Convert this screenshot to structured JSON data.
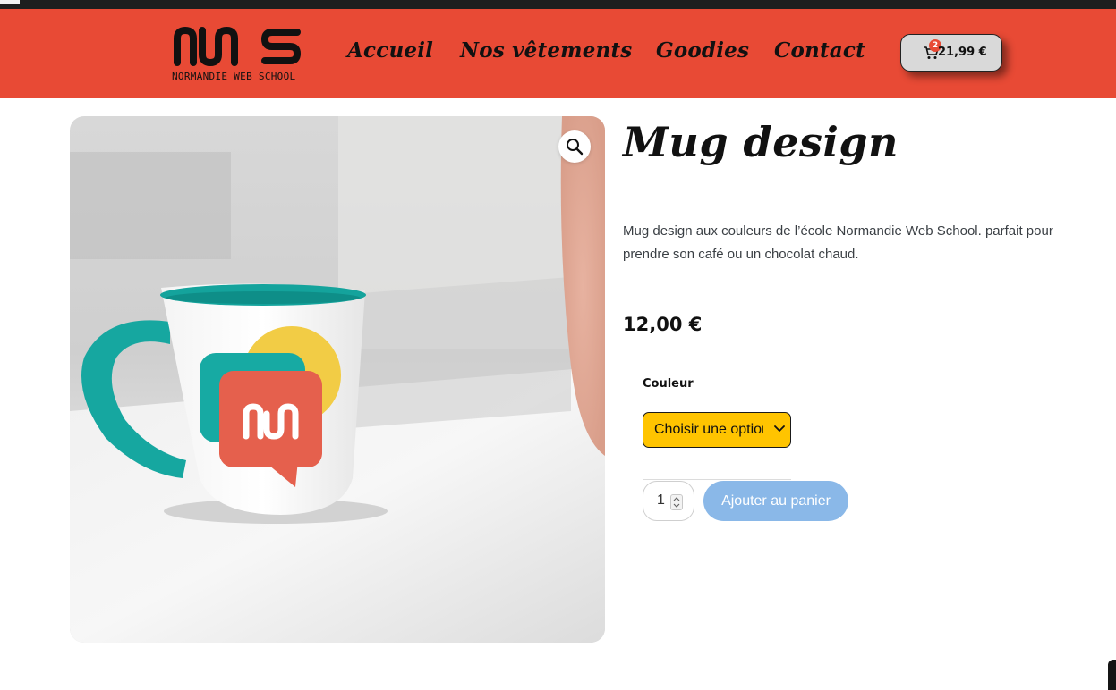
{
  "header": {
    "logo": {
      "text": "NWS",
      "subtitle": "NORMANDIE WEB SCHOOL"
    },
    "nav": [
      {
        "label": "Accueil"
      },
      {
        "label": "Nos vêtements"
      },
      {
        "label": "Goodies"
      },
      {
        "label": "Contact"
      }
    ],
    "cart": {
      "count": "2",
      "total": "21,99 €",
      "icon": "cart-icon"
    }
  },
  "product": {
    "title": "Mug design",
    "description": "Mug design aux couleurs de l’école Normandie Web School. parfait pour prendre son café ou un chocolat chaud.",
    "price": "12,00 €",
    "variation": {
      "label": "Couleur",
      "selected": "Choisir une option"
    },
    "quantity": "1",
    "add_to_cart_label": "Ajouter au panier",
    "image": {
      "zoom_icon": "search-icon"
    }
  },
  "colors": {
    "header_bg": "#e84a35",
    "select_bg": "#ffc400",
    "button_bg": "#8ab8e8",
    "mug_teal": "#17aaa3",
    "mug_yellow": "#f2cc45",
    "mug_red": "#e5604d"
  }
}
